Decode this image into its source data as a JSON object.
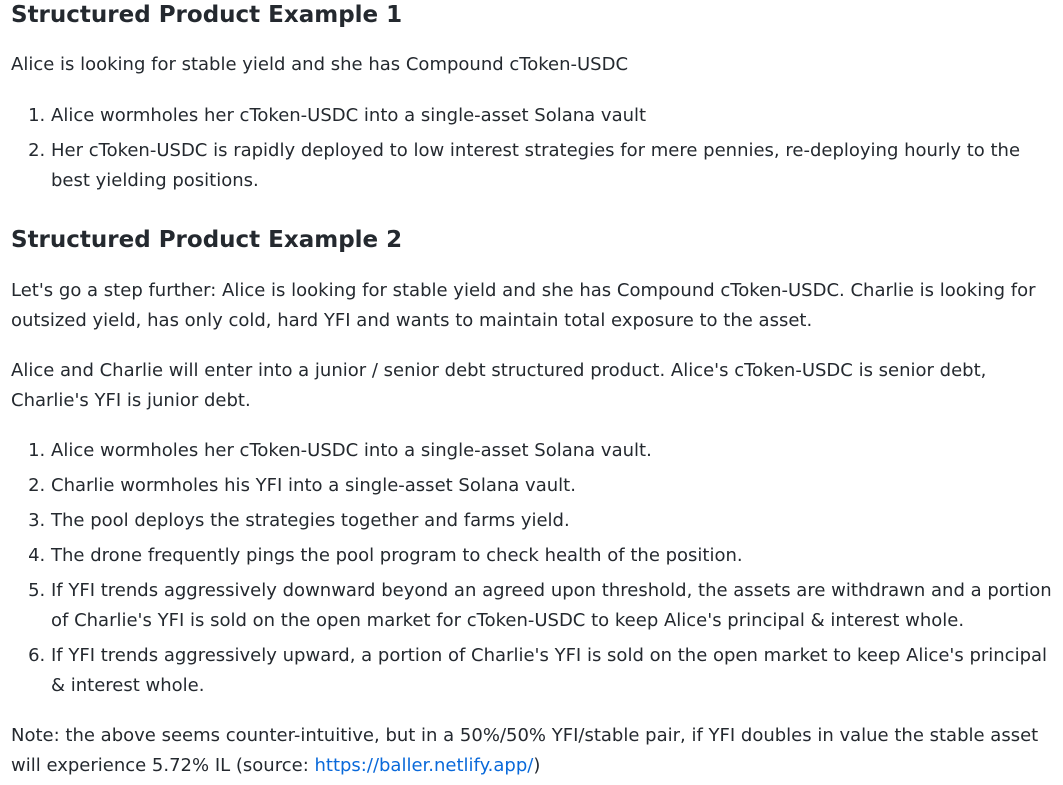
{
  "section1": {
    "heading": "Structured Product Example 1",
    "intro": "Alice is looking for stable yield and she has Compound cToken-USDC",
    "steps": [
      "Alice wormholes her cToken-USDC into a single-asset Solana vault",
      "Her cToken-USDC is rapidly deployed to low interest strategies for mere pennies, re-deploying hourly to the best yielding positions."
    ]
  },
  "section2": {
    "heading": "Structured Product Example 2",
    "intro": "Let's go a step further: Alice is looking for stable yield and she has Compound cToken-USDC. Charlie is looking for outsized yield, has only cold, hard YFI and wants to maintain total exposure to the asset.",
    "description": "Alice and Charlie will enter into a junior / senior debt structured product. Alice's cToken-USDC is senior debt, Charlie's YFI is junior debt.",
    "steps": [
      "Alice wormholes her cToken-USDC into a single-asset Solana vault.",
      "Charlie wormholes his YFI into a single-asset Solana vault.",
      "The pool deploys the strategies together and farms yield.",
      "The drone frequently pings the pool program to check health of the position.",
      "If YFI trends aggressively downward beyond an agreed upon threshold, the assets are withdrawn and a portion of Charlie's YFI is sold on the open market for cToken-USDC to keep Alice's principal & interest whole.",
      "If YFI trends aggressively upward, a portion of Charlie's YFI is sold on the open market to keep Alice's principal & interest whole."
    ],
    "note": {
      "text": "Note: the above seems counter-intuitive, but in a 50%/50% YFI/stable pair, if YFI doubles in value the stable asset will experience 5.72% IL (source: ",
      "link_text": "https://baller.netlify.app/",
      "link_href": "https://baller.netlify.app/",
      "suffix": ")"
    }
  }
}
